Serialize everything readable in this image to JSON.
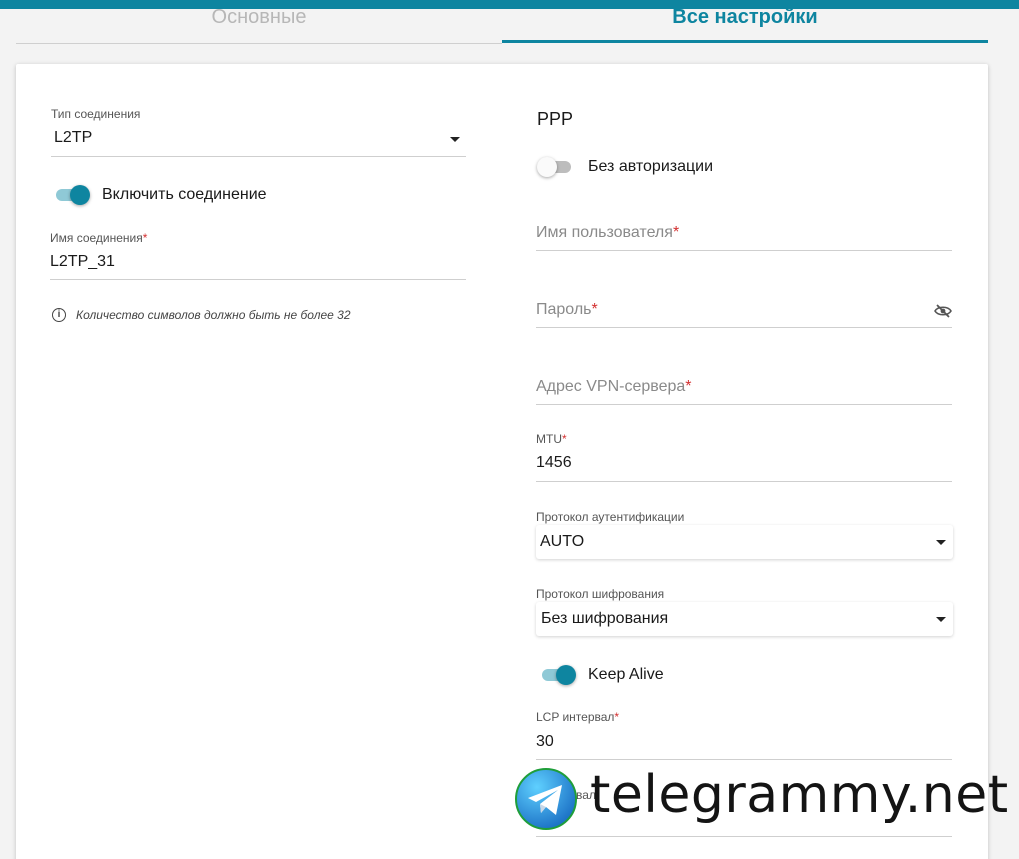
{
  "tabs": {
    "basic": "Основные",
    "all": "Все настройки"
  },
  "left": {
    "connection_type": {
      "label": "Тип соединения",
      "value": "L2TP"
    },
    "enable_connection": {
      "label": "Включить соединение",
      "on": true
    },
    "connection_name": {
      "label": "Имя соединения",
      "value": "L2TP_31"
    },
    "hint": "Количество символов должно быть не более 32"
  },
  "ppp": {
    "title": "PPP",
    "no_auth": {
      "label": "Без авторизации",
      "on": false
    },
    "username": {
      "placeholder": "Имя пользователя",
      "value": ""
    },
    "password": {
      "placeholder": "Пароль",
      "value": ""
    },
    "vpn_server": {
      "placeholder": "Адрес VPN-сервера",
      "value": ""
    },
    "mtu": {
      "label": "MTU",
      "value": "1456"
    },
    "auth_protocol": {
      "label": "Протокол аутентификации",
      "value": "AUTO"
    },
    "encryption_protocol": {
      "label": "Протокол шифрования",
      "value": "Без шифрования"
    },
    "keep_alive": {
      "label": "Keep Alive",
      "on": true
    },
    "lcp_interval": {
      "label": "LCP интервал",
      "value": "30"
    },
    "partial_label": "вал"
  },
  "watermark": {
    "text": "telegrammy.net"
  },
  "colors": {
    "accent": "#0e85a0",
    "required": "#d32f2f"
  },
  "icons": [
    "info-icon",
    "eye-off-icon",
    "chevron-down-icon",
    "telegram-logo-icon"
  ]
}
